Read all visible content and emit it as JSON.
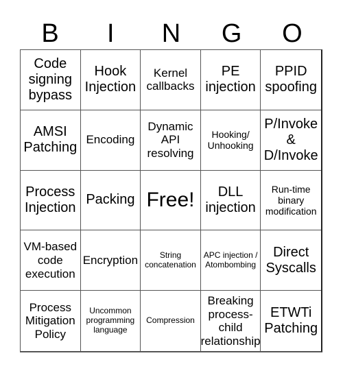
{
  "header": [
    "B",
    "I",
    "N",
    "G",
    "O"
  ],
  "cells": [
    {
      "text": "Code signing bypass",
      "size": "s-l"
    },
    {
      "text": "Hook Injection",
      "size": "s-l"
    },
    {
      "text": "Kernel callbacks",
      "size": "s-m"
    },
    {
      "text": "PE injection",
      "size": "s-l"
    },
    {
      "text": "PPID spoofing",
      "size": "s-l"
    },
    {
      "text": "AMSI Patching",
      "size": "s-l"
    },
    {
      "text": "Encoding",
      "size": "s-m"
    },
    {
      "text": "Dynamic API resolving",
      "size": "s-m"
    },
    {
      "text": "Hooking/ Unhooking",
      "size": "s-s"
    },
    {
      "text": "P/Invoke & D/Invoke",
      "size": "s-l"
    },
    {
      "text": "Process Injection",
      "size": "s-l"
    },
    {
      "text": "Packing",
      "size": "s-l"
    },
    {
      "text": "Free!",
      "size": "s-xl"
    },
    {
      "text": "DLL injection",
      "size": "s-l"
    },
    {
      "text": "Run-time binary modification",
      "size": "s-s"
    },
    {
      "text": "VM-based code execution",
      "size": "s-m"
    },
    {
      "text": "Encryption",
      "size": "s-m"
    },
    {
      "text": "String concatenation",
      "size": "s-xs"
    },
    {
      "text": "APC injection / Atombombing",
      "size": "s-xs"
    },
    {
      "text": "Direct Syscalls",
      "size": "s-l"
    },
    {
      "text": "Process Mitigation Policy",
      "size": "s-m"
    },
    {
      "text": "Uncommon programming language",
      "size": "s-xs"
    },
    {
      "text": "Compression",
      "size": "s-xs"
    },
    {
      "text": "Breaking process-child relationship",
      "size": "s-m"
    },
    {
      "text": "ETWTi Patching",
      "size": "s-l"
    }
  ]
}
